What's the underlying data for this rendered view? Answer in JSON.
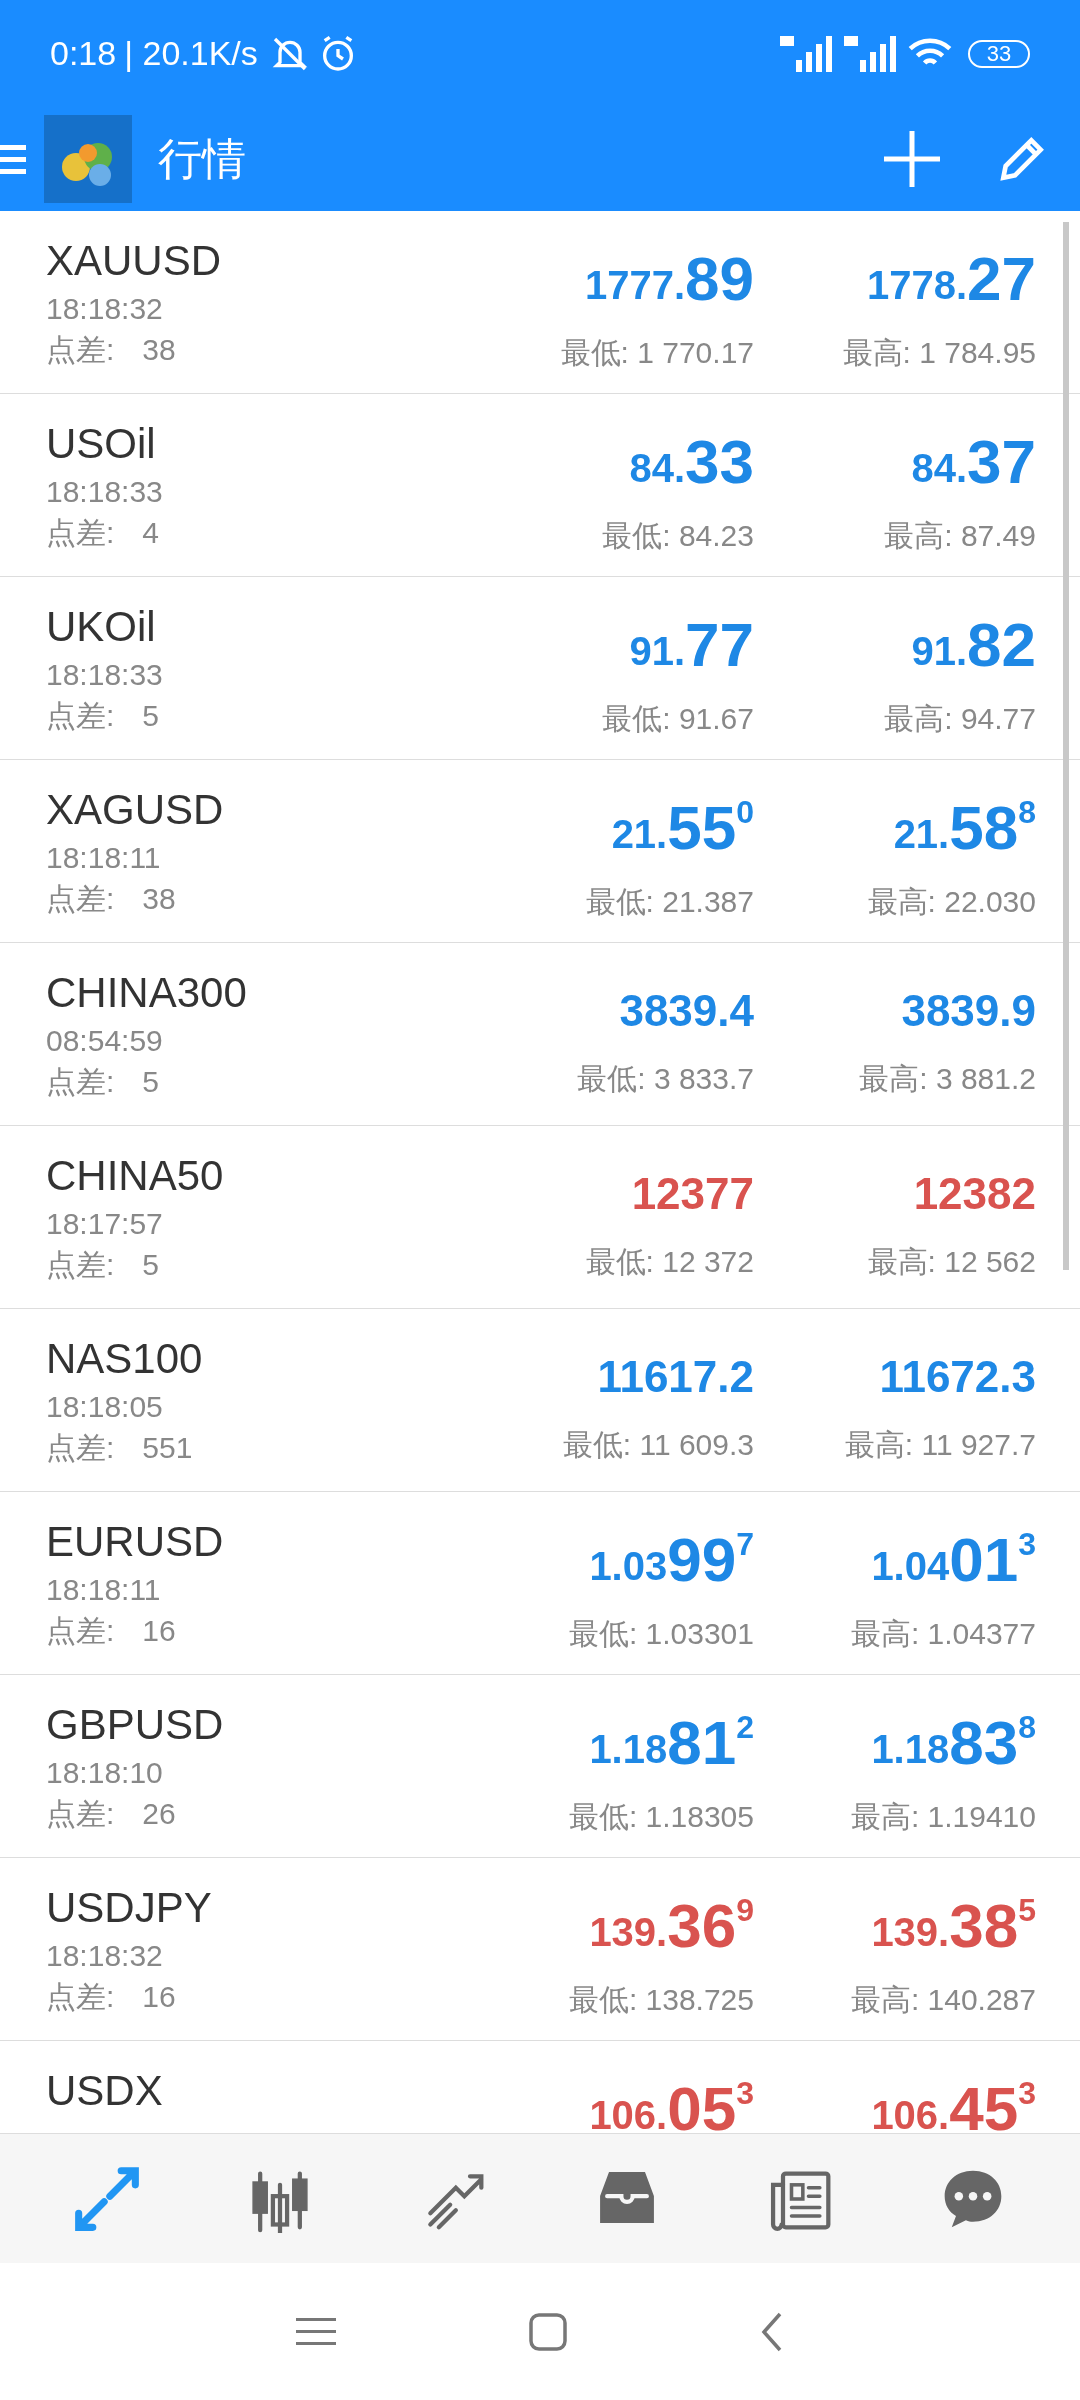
{
  "status_bar": {
    "time": "0:18",
    "speed": "| 20.1K/s",
    "battery": "33"
  },
  "toolbar": {
    "title": "行情"
  },
  "quotes": [
    {
      "symbol": "XAUUSD",
      "time": "18:18:32",
      "spread_label": "点差:",
      "spread": "38",
      "color": "#1e88e5",
      "bid": {
        "kind": "split",
        "pre": "1777.",
        "big": "89"
      },
      "ask": {
        "kind": "split",
        "pre": "1778.",
        "big": "27"
      },
      "low": "最低: 1 770.17",
      "high": "最高: 1 784.95"
    },
    {
      "symbol": "USOil",
      "time": "18:18:33",
      "spread_label": "点差:",
      "spread": "4",
      "color": "#1e88e5",
      "bid": {
        "kind": "split",
        "pre": "84.",
        "big": "33"
      },
      "ask": {
        "kind": "split",
        "pre": "84.",
        "big": "37"
      },
      "low": "最低: 84.23",
      "high": "最高: 87.49"
    },
    {
      "symbol": "UKOil",
      "time": "18:18:33",
      "spread_label": "点差:",
      "spread": "5",
      "color": "#1e88e5",
      "bid": {
        "kind": "split",
        "pre": "91.",
        "big": "77"
      },
      "ask": {
        "kind": "split",
        "pre": "91.",
        "big": "82"
      },
      "low": "最低: 91.67",
      "high": "最高: 94.77"
    },
    {
      "symbol": "XAGUSD",
      "time": "18:18:11",
      "spread_label": "点差:",
      "spread": "38",
      "color": "#1e88e5",
      "bid": {
        "kind": "split",
        "pre": "21.",
        "big": "55",
        "sup": "0"
      },
      "ask": {
        "kind": "split",
        "pre": "21.",
        "big": "58",
        "sup": "8"
      },
      "low": "最低: 21.387",
      "high": "最高: 22.030"
    },
    {
      "symbol": "CHINA300",
      "time": "08:54:59",
      "spread_label": "点差:",
      "spread": "5",
      "color": "#1e88e5",
      "bid": {
        "kind": "plain",
        "text": "3839.4"
      },
      "ask": {
        "kind": "plain",
        "text": "3839.9"
      },
      "low": "最低: 3 833.7",
      "high": "最高: 3 881.2"
    },
    {
      "symbol": "CHINA50",
      "time": "18:17:57",
      "spread_label": "点差:",
      "spread": "5",
      "color": "#d9534f",
      "bid": {
        "kind": "plain",
        "text": "12377"
      },
      "ask": {
        "kind": "plain",
        "text": "12382"
      },
      "low": "最低: 12 372",
      "high": "最高: 12 562"
    },
    {
      "symbol": "NAS100",
      "time": "18:18:05",
      "spread_label": "点差:",
      "spread": "551",
      "color": "#1e88e5",
      "bid": {
        "kind": "plain",
        "text": "11617.2"
      },
      "ask": {
        "kind": "plain",
        "text": "11672.3"
      },
      "low": "最低: 11 609.3",
      "high": "最高: 11 927.7"
    },
    {
      "symbol": "EURUSD",
      "time": "18:18:11",
      "spread_label": "点差:",
      "spread": "16",
      "color": "#1e88e5",
      "bid": {
        "kind": "split",
        "pre": "1.03",
        "big": "99",
        "sup": "7"
      },
      "ask": {
        "kind": "split",
        "pre": "1.04",
        "big": "01",
        "sup": "3"
      },
      "low": "最低: 1.03301",
      "high": "最高: 1.04377"
    },
    {
      "symbol": "GBPUSD",
      "time": "18:18:10",
      "spread_label": "点差:",
      "spread": "26",
      "color": "#1e88e5",
      "bid": {
        "kind": "split",
        "pre": "1.18",
        "big": "81",
        "sup": "2"
      },
      "ask": {
        "kind": "split",
        "pre": "1.18",
        "big": "83",
        "sup": "8"
      },
      "low": "最低: 1.18305",
      "high": "最高: 1.19410"
    },
    {
      "symbol": "USDJPY",
      "time": "18:18:32",
      "spread_label": "点差:",
      "spread": "16",
      "color": "#d9534f",
      "bid": {
        "kind": "split",
        "pre": "139.",
        "big": "36",
        "sup": "9"
      },
      "ask": {
        "kind": "split",
        "pre": "139.",
        "big": "38",
        "sup": "5"
      },
      "low": "最低: 138.725",
      "high": "最高: 140.287"
    },
    {
      "symbol": "USDX",
      "color": "#d9534f",
      "bid": {
        "kind": "split",
        "pre": "106.",
        "big": "05",
        "sup": "3"
      },
      "ask": {
        "kind": "split",
        "pre": "106.",
        "big": "45",
        "sup": "3"
      }
    }
  ],
  "bottom_nav": [
    {
      "kind": "quotes",
      "selected": true
    },
    {
      "kind": "chart",
      "selected": false
    },
    {
      "kind": "trade",
      "selected": false
    },
    {
      "kind": "history",
      "selected": false
    },
    {
      "kind": "news",
      "selected": false
    },
    {
      "kind": "chat",
      "selected": false
    }
  ]
}
